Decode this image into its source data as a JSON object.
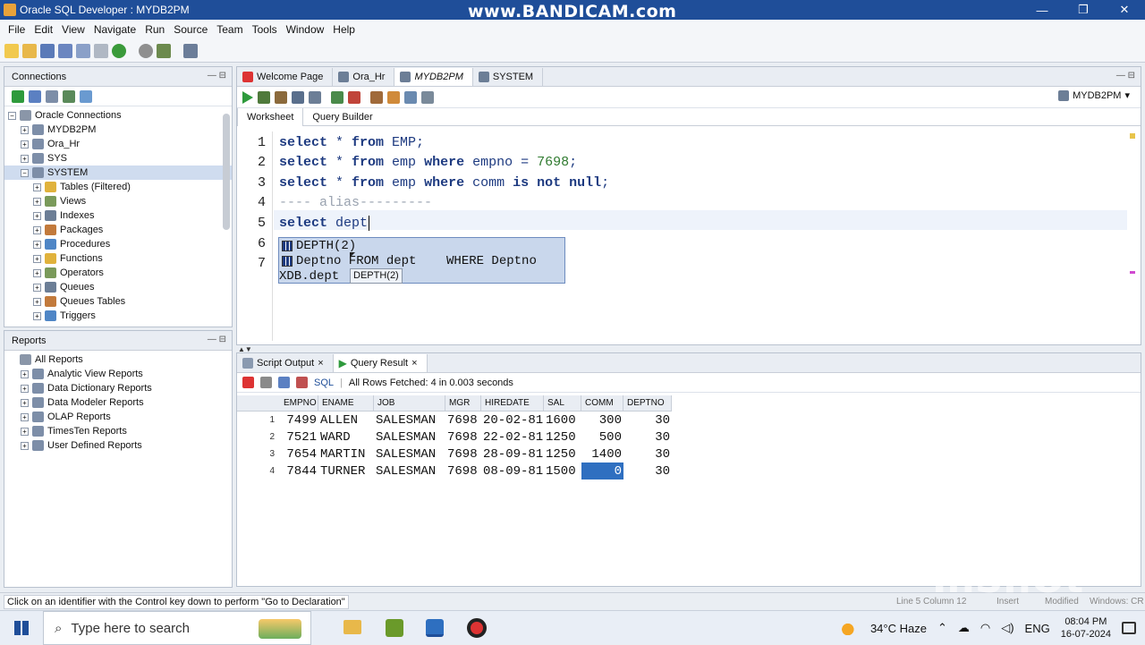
{
  "window": {
    "title": "Oracle SQL Developer : MYDB2PM",
    "watermark": "www.BANDICAM.com",
    "controls": [
      "—",
      "❐",
      "✕"
    ]
  },
  "menu": [
    "File",
    "Edit",
    "View",
    "Navigate",
    "Run",
    "Source",
    "Team",
    "Tools",
    "Window",
    "Help"
  ],
  "connections": {
    "header": "Connections",
    "items": [
      {
        "label": "Oracle Connections",
        "level": 0,
        "toggle": "−"
      },
      {
        "label": "MYDB2PM",
        "level": 1,
        "toggle": "+"
      },
      {
        "label": "Ora_Hr",
        "level": 1,
        "toggle": "+"
      },
      {
        "label": "SYS",
        "level": 1,
        "toggle": "+"
      },
      {
        "label": "SYSTEM",
        "level": 1,
        "toggle": "−",
        "selected": true
      },
      {
        "label": "Tables (Filtered)",
        "level": 2,
        "toggle": "+"
      },
      {
        "label": "Views",
        "level": 2,
        "toggle": "+"
      },
      {
        "label": "Indexes",
        "level": 2,
        "toggle": "+"
      },
      {
        "label": "Packages",
        "level": 2,
        "toggle": "+"
      },
      {
        "label": "Procedures",
        "level": 2,
        "toggle": "+"
      },
      {
        "label": "Functions",
        "level": 2,
        "toggle": "+"
      },
      {
        "label": "Operators",
        "level": 2,
        "toggle": "+"
      },
      {
        "label": "Queues",
        "level": 2,
        "toggle": "+"
      },
      {
        "label": "Queues Tables",
        "level": 2,
        "toggle": "+"
      },
      {
        "label": "Triggers",
        "level": 2,
        "toggle": "+"
      }
    ]
  },
  "reports": {
    "header": "Reports",
    "items": [
      {
        "label": "All Reports",
        "level": 0,
        "toggle": ""
      },
      {
        "label": "Analytic View Reports",
        "level": 1,
        "toggle": "+"
      },
      {
        "label": "Data Dictionary Reports",
        "level": 1,
        "toggle": "+"
      },
      {
        "label": "Data Modeler Reports",
        "level": 1,
        "toggle": "+"
      },
      {
        "label": "OLAP Reports",
        "level": 1,
        "toggle": "+"
      },
      {
        "label": "TimesTen Reports",
        "level": 1,
        "toggle": "+"
      },
      {
        "label": "User Defined Reports",
        "level": 1,
        "toggle": "+"
      }
    ]
  },
  "editor": {
    "tabs": [
      {
        "label": "Welcome Page",
        "active": false
      },
      {
        "label": "Ora_Hr",
        "active": false
      },
      {
        "label": "MYDB2PM",
        "active": true
      },
      {
        "label": "SYSTEM",
        "active": false
      }
    ],
    "connection_selector": "MYDB2PM",
    "subtabs": [
      "Worksheet",
      "Query Builder"
    ],
    "line_numbers": [
      "1",
      "2",
      "3",
      "4",
      "5",
      "6",
      "7"
    ],
    "lines": {
      "l1": {
        "k1": "select",
        "t1": " * ",
        "k2": "from",
        "t2": " EMP;"
      },
      "l2": {
        "k1": "select",
        "t1": " * ",
        "k2": "from",
        "t2": " emp ",
        "k3": "where",
        "t3": " empno = ",
        "n": "7698",
        "t4": ";"
      },
      "l3": {
        "k1": "select",
        "t1": " * ",
        "k2": "from",
        "t2": " emp ",
        "k3": "where",
        "t3": " comm ",
        "k4": "is not null",
        "t4": ";"
      },
      "l4": "---- alias---------",
      "l5": {
        "k1": "select",
        "t1": " dept"
      }
    },
    "autocomplete": {
      "items": [
        "DEPTH(2)",
        "Deptno FROM dept    WHERE Deptno",
        "XDB.dept"
      ],
      "tooltip": "DEPTH(2)"
    }
  },
  "results": {
    "tabs": [
      {
        "label": "Script Output"
      },
      {
        "label": "Query Result"
      }
    ],
    "sql_label": "SQL",
    "status": "All Rows Fetched: 4 in 0.003 seconds",
    "columns": [
      "EMPNO",
      "ENAME",
      "JOB",
      "MGR",
      "HIREDATE",
      "SAL",
      "COMM",
      "DEPTNO"
    ],
    "rows": [
      [
        "1",
        "7499",
        "ALLEN",
        "SALESMAN",
        "7698",
        "20-02-81",
        "1600",
        "300",
        "30"
      ],
      [
        "2",
        "7521",
        "WARD",
        "SALESMAN",
        "7698",
        "22-02-81",
        "1250",
        "500",
        "30"
      ],
      [
        "3",
        "7654",
        "MARTIN",
        "SALESMAN",
        "7698",
        "28-09-81",
        "1250",
        "1400",
        "30"
      ],
      [
        "4",
        "7844",
        "TURNER",
        "SALESMAN",
        "7698",
        "08-09-81",
        "1500",
        "0",
        "30"
      ]
    ]
  },
  "statusbar": {
    "hint": "Click on an identifier with the Control key down to perform \"Go to Declaration\"",
    "position": "Line 5 Column 12",
    "mode": "Insert",
    "state": "Modified",
    "os": "Windows: CR",
    "overlay": "InShOt"
  },
  "taskbar": {
    "search_placeholder": "Type here to search",
    "weather": "34°C  Haze",
    "lang": "ENG",
    "time": "08:04 PM",
    "date": "16-07-2024"
  },
  "colors": {
    "accent": "#1f4e99",
    "selection": "#2f6fc0",
    "autocomplete_bg": "#c9d7ec"
  }
}
